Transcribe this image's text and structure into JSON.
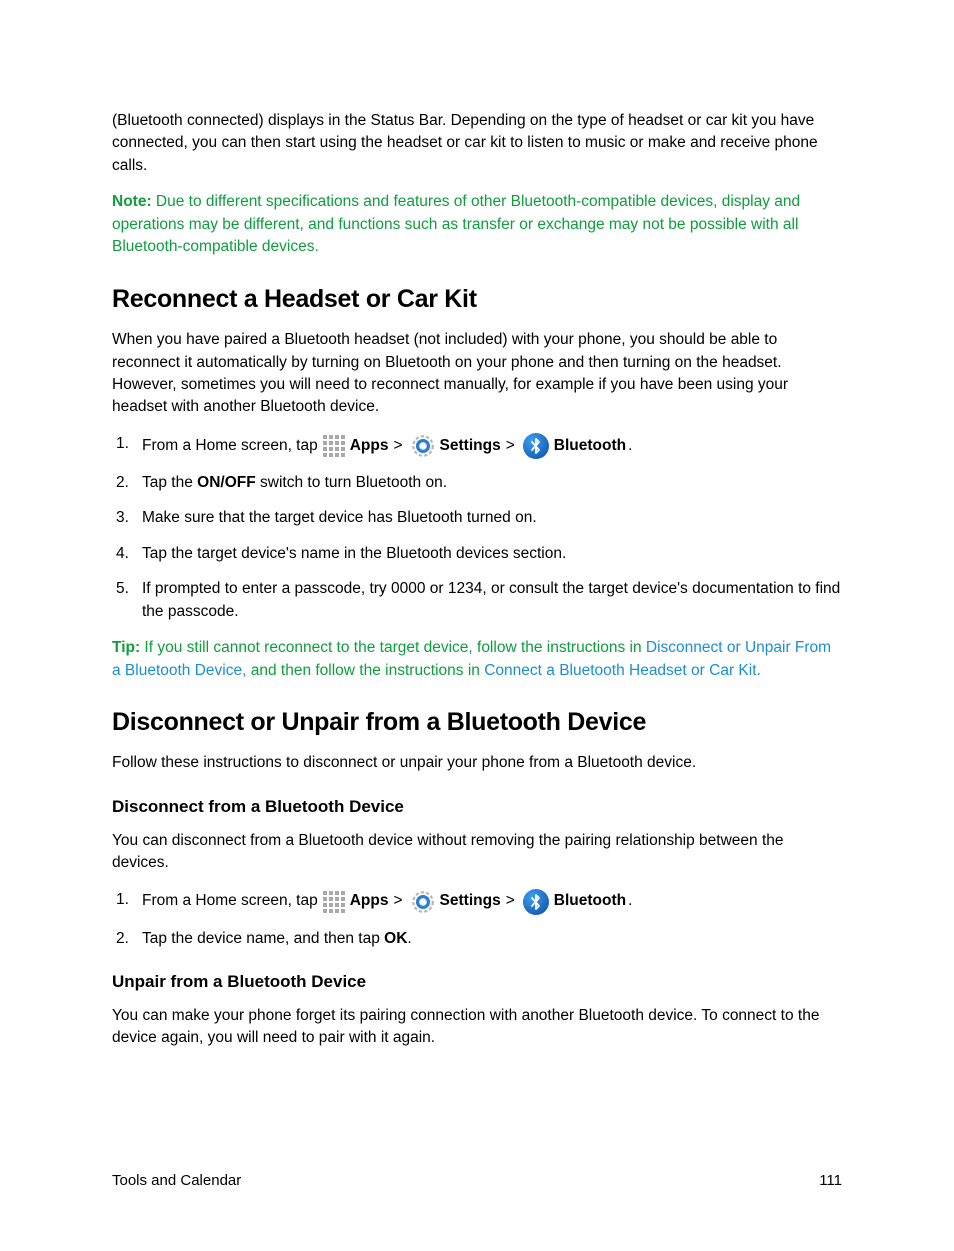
{
  "intro_para": "(Bluetooth connected) displays in the Status Bar. Depending on the type of headset or car kit you have connected, you can then start using the headset or car kit to listen to music or make and receive phone calls.",
  "note_label": "Note:",
  "note_text": " Due to different specifications and features of other Bluetooth-compatible devices, display and operations may be different, and functions such as transfer or exchange may not be possible with all Bluetooth-compatible devices.",
  "h1_reconnect": "Reconnect a Headset or Car Kit",
  "reconnect_intro": "When you have paired a Bluetooth headset (not included) with your phone, you should be able to reconnect it automatically by turning on Bluetooth on your phone and then turning on the headset. However, sometimes you will need to reconnect manually, for example if you have been using your headset with another Bluetooth device.",
  "steps_reconnect": {
    "n1": "1.",
    "n2": "2.",
    "n3": "3.",
    "n4": "4.",
    "n5": "5.",
    "s1_prefix": "From a Home screen, tap",
    "apps_label": "Apps",
    "settings_label": "Settings",
    "bluetooth_label": "Bluetooth",
    "gt": ">",
    "period": ".",
    "s2_a": "Tap the ",
    "s2_b": "ON/OFF",
    "s2_c": " switch to turn Bluetooth on.",
    "s3": "Make sure that the target device has Bluetooth turned on.",
    "s4": "Tap the target device's name in the Bluetooth devices section.",
    "s5": "If prompted to enter a passcode, try 0000 or 1234, or consult the target device's documentation to find the passcode."
  },
  "tip_label": "Tip:",
  "tip_a": " If you still cannot reconnect to the target device, follow the instructions in ",
  "tip_link1": "Disconnect or Unpair From a Bluetooth Device,",
  "tip_b": " and then follow the instructions in ",
  "tip_link2": "Connect a Bluetooth Headset or Car Kit",
  "tip_c": ".",
  "h1_disconnect": "Disconnect or Unpair from a Bluetooth Device",
  "disconnect_intro": "Follow these instructions to disconnect or unpair your phone from a Bluetooth device.",
  "h2_disconnect": "Disconnect from a Bluetooth Device",
  "disconnect_sub_intro": "You can disconnect from a Bluetooth device without removing the pairing relationship between the devices.",
  "steps_disconnect": {
    "n1": "1.",
    "n2": "2.",
    "s2_a": "Tap the device name, and then tap ",
    "s2_b": "OK",
    "s2_c": "."
  },
  "h2_unpair": "Unpair from a Bluetooth Device",
  "unpair_intro": "You can make your phone forget its pairing connection with another Bluetooth device. To connect to the device again, you will need to pair with it again.",
  "footer_left": "Tools and Calendar",
  "footer_right": "111"
}
